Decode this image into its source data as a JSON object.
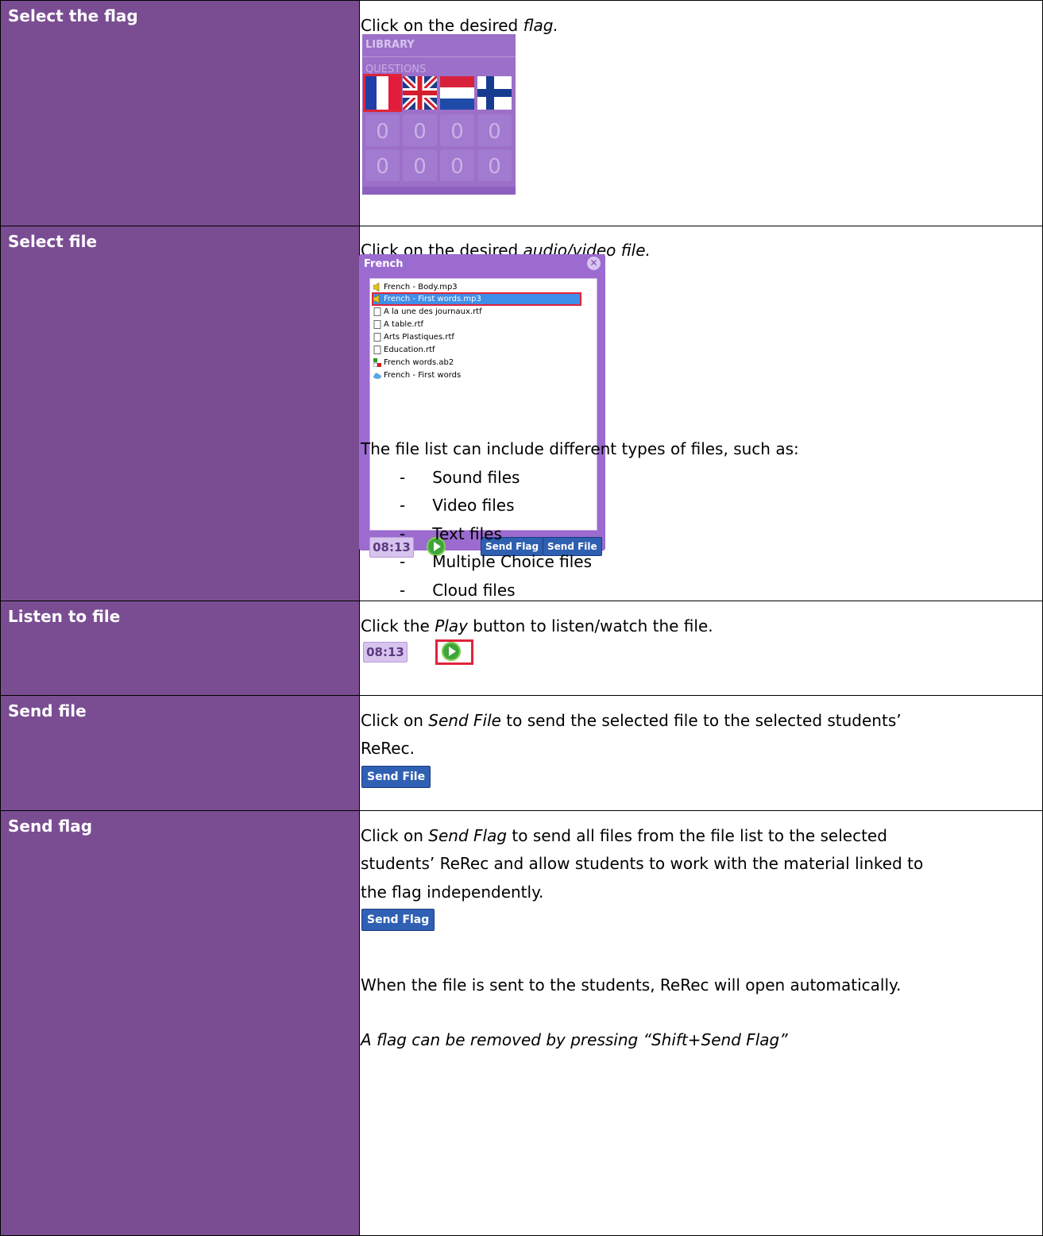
{
  "rows": [
    {
      "label": "Select the flag",
      "pre": "Click on the desired ",
      "em": "flag."
    },
    {
      "label": "Select file",
      "pre": "Click on the desired ",
      "em": "audio/video file.",
      "intro": "The file list can include different types of files, such as:",
      "bullets": [
        "Sound files",
        "Video files",
        "Text files",
        "Multiple Choice files",
        "Cloud files"
      ]
    },
    {
      "label": "Listen to file",
      "pre": "Click the ",
      "em": "Play",
      "post": " button to listen/watch the file."
    },
    {
      "label": "Send file",
      "pre": "Click on ",
      "em": "Send File",
      "post": " to send the selected file to the selected students’",
      "line2": "ReRec."
    },
    {
      "label": "Send flag",
      "pre": "Click on ",
      "em": "Send Flag",
      "post": " to send all files from the file list to the selected",
      "line2": "students’ ReRec and allow students to work with the material linked to",
      "line3": "the flag independently.",
      "note": "When the file is sent to the students, ReRec will open automatically.",
      "tip": "A flag can be removed by pressing “Shift+Send Flag”"
    }
  ],
  "library": {
    "title": "LIBRARY",
    "subtitle": "QUESTIONS",
    "slot_glyph": "0"
  },
  "dialog": {
    "title": "French",
    "close": "✕",
    "files": [
      "French - Body.mp3",
      "French - First words.mp3",
      "A la une des journaux.rtf",
      "A table.rtf",
      "Arts Plastiques.rtf",
      "Education.rtf",
      "French words.ab2",
      "French - First words"
    ],
    "timer": "08:13",
    "send_flag": "Send Flag",
    "send_file": "Send File"
  },
  "listen_timer": "08:13",
  "send_file_button": "Send File",
  "send_flag_button": "Send Flag",
  "bullet_dash": "-",
  "colors": {
    "label_bg": "#7a4d92",
    "panel_bg": "#9b6bd0",
    "button_bg": "#2f5fb1",
    "selection": "#3f8ee8",
    "highlight": "#e0243a"
  }
}
